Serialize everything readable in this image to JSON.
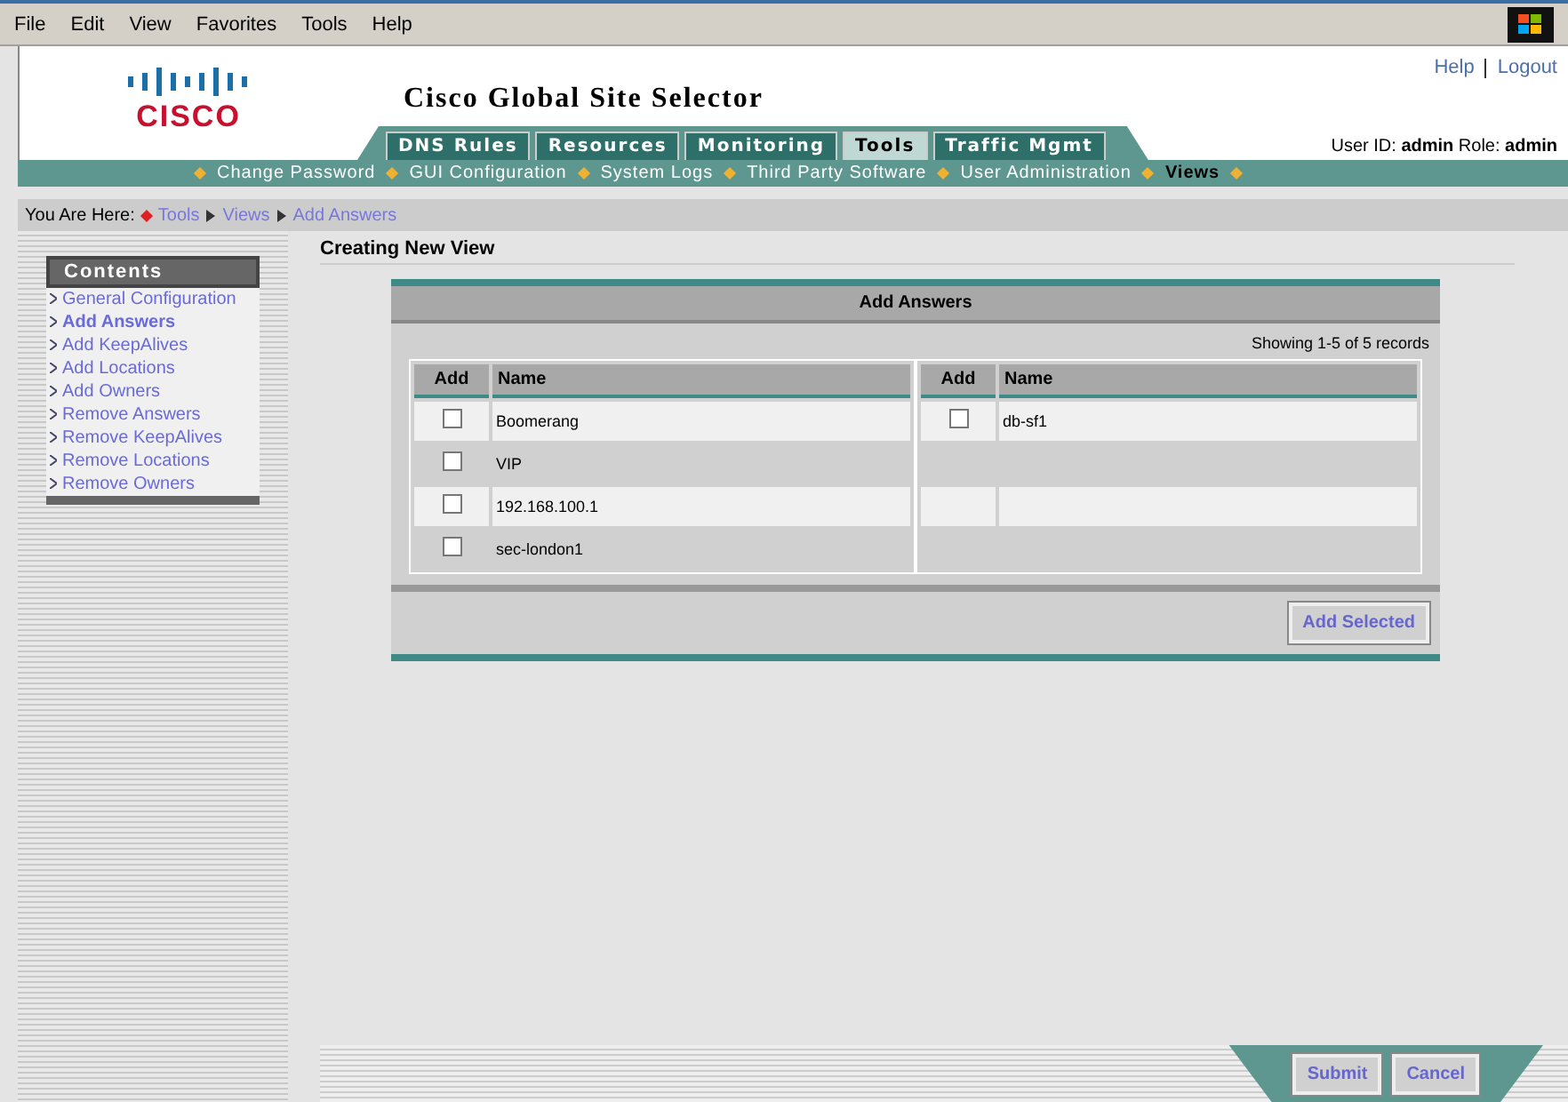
{
  "menu_bar": [
    "File",
    "Edit",
    "View",
    "Favorites",
    "Tools",
    "Help"
  ],
  "header": {
    "logo": "CISCO",
    "title": "Cisco Global Site Selector",
    "links": [
      "Help",
      "Logout"
    ],
    "user_label": "User ID:",
    "user": "admin",
    "role_label": "Role:",
    "role": "admin"
  },
  "tabs": [
    {
      "label": "DNS Rules",
      "selected": false
    },
    {
      "label": "Resources",
      "selected": false
    },
    {
      "label": "Monitoring",
      "selected": false
    },
    {
      "label": "Tools",
      "selected": true
    },
    {
      "label": "Traffic Mgmt",
      "selected": false
    }
  ],
  "subnav": [
    {
      "label": "Change Password",
      "selected": false
    },
    {
      "label": "GUI Configuration",
      "selected": false
    },
    {
      "label": "System Logs",
      "selected": false
    },
    {
      "label": "Third Party Software",
      "selected": false
    },
    {
      "label": "User Administration",
      "selected": false
    },
    {
      "label": "Views",
      "selected": true
    }
  ],
  "breadcrumb": {
    "label": "You Are Here:",
    "items": [
      "Tools",
      "Views",
      "Add Answers"
    ]
  },
  "sidebar": {
    "title": "Contents",
    "items": [
      {
        "label": "General Configuration",
        "selected": false
      },
      {
        "label": "Add Answers",
        "selected": true
      },
      {
        "label": "Add KeepAlives",
        "selected": false
      },
      {
        "label": "Add Locations",
        "selected": false
      },
      {
        "label": "Add Owners",
        "selected": false
      },
      {
        "label": "Remove Answers",
        "selected": false
      },
      {
        "label": "Remove KeepAlives",
        "selected": false
      },
      {
        "label": "Remove Locations",
        "selected": false
      },
      {
        "label": "Remove Owners",
        "selected": false
      }
    ]
  },
  "page_title": "Creating New View",
  "panel": {
    "title": "Add Answers",
    "record_count": "Showing 1-5 of 5 records",
    "tables": [
      {
        "columns": [
          "Add",
          "Name"
        ],
        "rows": [
          {
            "name": "Boomerang",
            "checked": false
          },
          {
            "name": "VIP",
            "checked": false
          },
          {
            "name": "192.168.100.1",
            "checked": false
          },
          {
            "name": "sec-london1",
            "checked": false
          }
        ]
      },
      {
        "columns": [
          "Add",
          "Name"
        ],
        "rows": [
          {
            "name": "db-sf1",
            "checked": false
          }
        ]
      }
    ],
    "button": "Add Selected"
  },
  "footer_buttons": [
    "Submit",
    "Cancel"
  ]
}
